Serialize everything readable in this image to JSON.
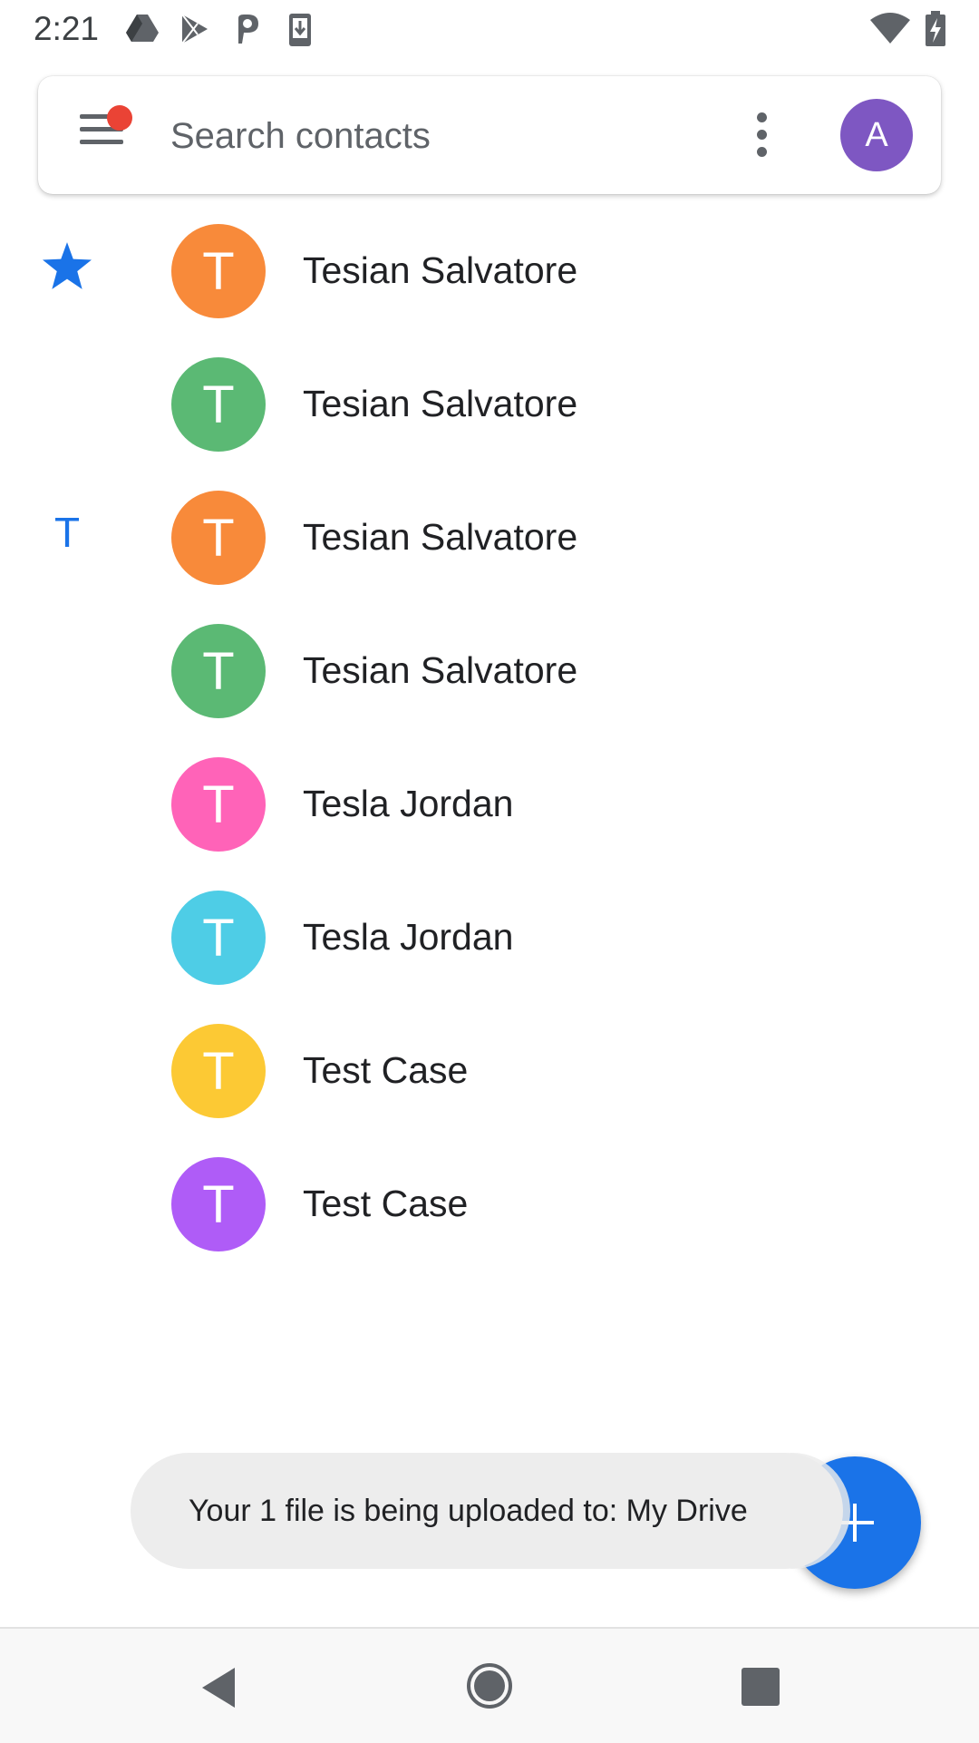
{
  "status_bar": {
    "time": "2:21",
    "icons": [
      "drive-icon",
      "play-store-icon",
      "parking-icon",
      "download-icon",
      "wifi-icon",
      "battery-charging-icon"
    ]
  },
  "search": {
    "placeholder": "Search contacts",
    "account_initial": "A",
    "account_color": "#7e57c2",
    "menu_badge_color": "#ea4335"
  },
  "contacts": [
    {
      "name": "Tesian Salvatore",
      "initial": "T",
      "color": "#f88a3a",
      "marker": "star"
    },
    {
      "name": "Tesian Salvatore",
      "initial": "T",
      "color": "#5bb974",
      "marker": ""
    },
    {
      "name": "Tesian Salvatore",
      "initial": "T",
      "color": "#f88a3a",
      "marker": "T"
    },
    {
      "name": "Tesian Salvatore",
      "initial": "T",
      "color": "#5bb974",
      "marker": ""
    },
    {
      "name": "Tesla Jordan",
      "initial": "T",
      "color": "#ff63b8",
      "marker": ""
    },
    {
      "name": "Tesla Jordan",
      "initial": "T",
      "color": "#4ecde6",
      "marker": ""
    },
    {
      "name": "Test Case",
      "initial": "T",
      "color": "#fcc934",
      "marker": ""
    },
    {
      "name": "Test Case",
      "initial": "T",
      "color": "#af5cf7",
      "marker": ""
    }
  ],
  "snackbar": {
    "message": "Your 1 file is being uploaded to: My Drive"
  },
  "fab": {
    "icon": "plus-icon",
    "color": "#1a73e8"
  },
  "nav": {
    "icons": [
      "back-icon",
      "home-icon",
      "recents-icon"
    ]
  },
  "colors": {
    "accent": "#1a73e8"
  }
}
